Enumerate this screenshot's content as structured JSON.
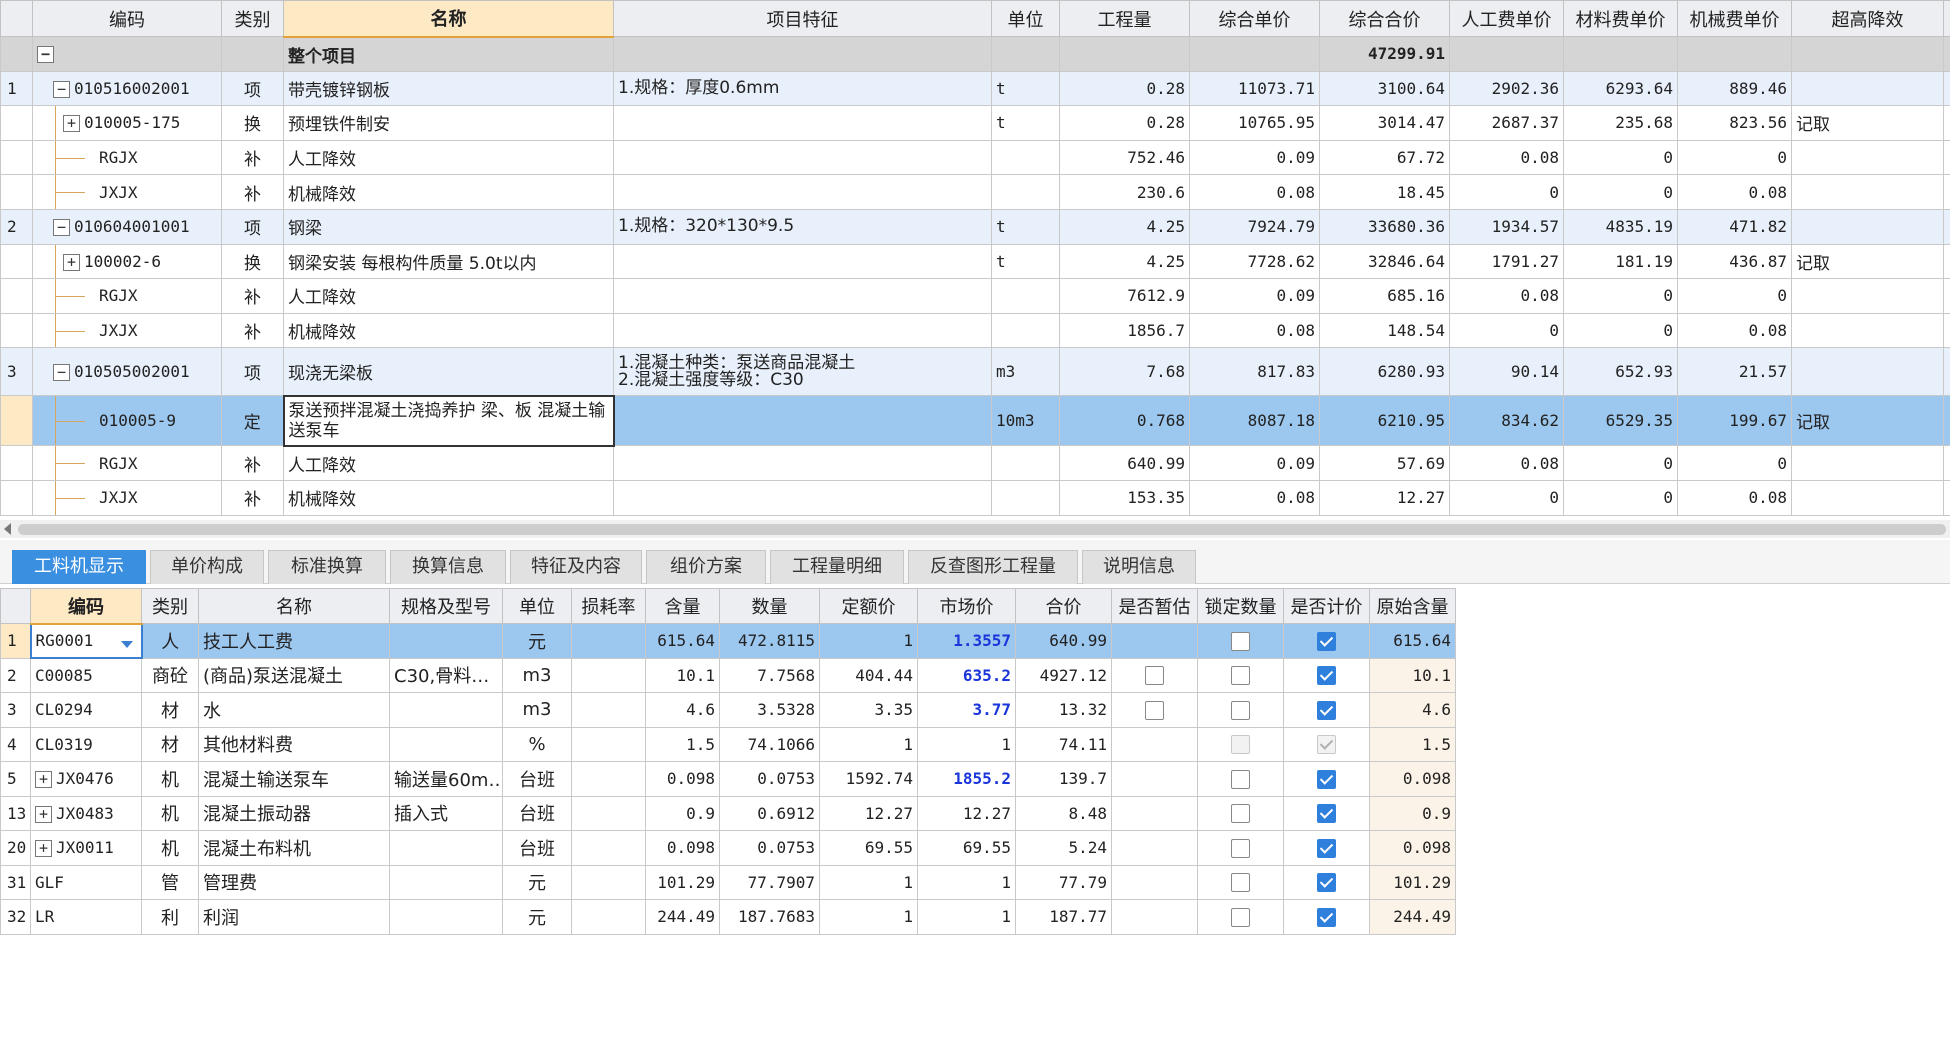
{
  "upper": {
    "headers": [
      "编码",
      "类别",
      "名称",
      "项目特征",
      "单位",
      "工程量",
      "综合单价",
      "综合合价",
      "人工费单价",
      "材料费单价",
      "机械费单价",
      "超高降效"
    ],
    "root": {
      "name": "整个项目",
      "total": "47299.91"
    },
    "rows": [
      {
        "no": "1",
        "code": "010516002001",
        "type": "项",
        "name": "带壳镀锌钢板",
        "feature": "1.规格：厚度0.6mm",
        "unit": "t",
        "qty": "0.28",
        "price": "11073.71",
        "total": "3100.64",
        "labor": "2902.36",
        "material": "6293.64",
        "machine": "889.46",
        "extra": ""
      },
      {
        "no": "",
        "code": "010005-175",
        "type": "换",
        "name": "预埋铁件制安",
        "feature": "",
        "unit": "t",
        "qty": "0.28",
        "price": "10765.95",
        "total": "3014.47",
        "labor": "2687.37",
        "material": "235.68",
        "machine": "823.56",
        "extra": "记取"
      },
      {
        "no": "",
        "code": "RGJX",
        "type": "补",
        "name": "人工降效",
        "feature": "",
        "unit": "",
        "qty": "752.46",
        "price": "0.09",
        "total": "67.72",
        "labor": "0.08",
        "material": "0",
        "machine": "0",
        "extra": ""
      },
      {
        "no": "",
        "code": "JXJX",
        "type": "补",
        "name": "机械降效",
        "feature": "",
        "unit": "",
        "qty": "230.6",
        "price": "0.08",
        "total": "18.45",
        "labor": "0",
        "material": "0",
        "machine": "0.08",
        "extra": ""
      },
      {
        "no": "2",
        "code": "010604001001",
        "type": "项",
        "name": "钢梁",
        "feature": "1.规格：320*130*9.5",
        "unit": "t",
        "qty": "4.25",
        "price": "7924.79",
        "total": "33680.36",
        "labor": "1934.57",
        "material": "4835.19",
        "machine": "471.82",
        "extra": ""
      },
      {
        "no": "",
        "code": "100002-6",
        "type": "换",
        "name": "钢梁安装 每根构件质量 5.0t以内",
        "feature": "",
        "unit": "t",
        "qty": "4.25",
        "price": "7728.62",
        "total": "32846.64",
        "labor": "1791.27",
        "material": "181.19",
        "machine": "436.87",
        "extra": "记取"
      },
      {
        "no": "",
        "code": "RGJX",
        "type": "补",
        "name": "人工降效",
        "feature": "",
        "unit": "",
        "qty": "7612.9",
        "price": "0.09",
        "total": "685.16",
        "labor": "0.08",
        "material": "0",
        "machine": "0",
        "extra": ""
      },
      {
        "no": "",
        "code": "JXJX",
        "type": "补",
        "name": "机械降效",
        "feature": "",
        "unit": "",
        "qty": "1856.7",
        "price": "0.08",
        "total": "148.54",
        "labor": "0",
        "material": "0",
        "machine": "0.08",
        "extra": ""
      },
      {
        "no": "3",
        "code": "010505002001",
        "type": "项",
        "name": "现浇无梁板",
        "feature": "1.混凝土种类：泵送商品混凝土\n2.混凝土强度等级：C30",
        "unit": "m3",
        "qty": "7.68",
        "price": "817.83",
        "total": "6280.93",
        "labor": "90.14",
        "material": "652.93",
        "machine": "21.57",
        "extra": ""
      },
      {
        "no": "",
        "code": "010005-9",
        "type": "定",
        "name": "泵送预拌混凝土浇捣养护 梁、板 混凝土输送泵车",
        "feature": "",
        "unit": "10m3",
        "qty": "0.768",
        "price": "8087.18",
        "total": "6210.95",
        "labor": "834.62",
        "material": "6529.35",
        "machine": "199.67",
        "extra": "记取"
      },
      {
        "no": "",
        "code": "RGJX",
        "type": "补",
        "name": "人工降效",
        "feature": "",
        "unit": "",
        "qty": "640.99",
        "price": "0.09",
        "total": "57.69",
        "labor": "0.08",
        "material": "0",
        "machine": "0",
        "extra": ""
      },
      {
        "no": "",
        "code": "JXJX",
        "type": "补",
        "name": "机械降效",
        "feature": "",
        "unit": "",
        "qty": "153.35",
        "price": "0.08",
        "total": "12.27",
        "labor": "0",
        "material": "0",
        "machine": "0.08",
        "extra": ""
      }
    ]
  },
  "tabs": [
    "工料机显示",
    "单价构成",
    "标准换算",
    "换算信息",
    "特征及内容",
    "组价方案",
    "工程量明细",
    "反查图形工程量",
    "说明信息"
  ],
  "lower": {
    "headers": [
      "编码",
      "类别",
      "名称",
      "规格及型号",
      "单位",
      "损耗率",
      "含量",
      "数量",
      "定额价",
      "市场价",
      "合价",
      "是否暂估",
      "锁定数量",
      "是否计价",
      "原始含量"
    ],
    "rows": [
      {
        "no": "1",
        "code": "RG0001",
        "type": "人",
        "name": "技工人工费",
        "spec": "",
        "unit": "元",
        "loss": "",
        "content": "615.64",
        "qty": "472.8115",
        "quota": "1",
        "market": "1.3557",
        "total": "640.99",
        "orig": "615.64"
      },
      {
        "no": "2",
        "code": "C00085",
        "type": "商砼",
        "name": "(商品)泵送混凝土",
        "spec": "C30,骨料…",
        "unit": "m3",
        "loss": "",
        "content": "10.1",
        "qty": "7.7568",
        "quota": "404.44",
        "market": "635.2",
        "total": "4927.12",
        "orig": "10.1"
      },
      {
        "no": "3",
        "code": "CL0294",
        "type": "材",
        "name": "水",
        "spec": "",
        "unit": "m3",
        "loss": "",
        "content": "4.6",
        "qty": "3.5328",
        "quota": "3.35",
        "market": "3.77",
        "total": "13.32",
        "orig": "4.6"
      },
      {
        "no": "4",
        "code": "CL0319",
        "type": "材",
        "name": "其他材料费",
        "spec": "",
        "unit": "%",
        "loss": "",
        "content": "1.5",
        "qty": "74.1066",
        "quota": "1",
        "market": "1",
        "total": "74.11",
        "orig": "1.5"
      },
      {
        "no": "5",
        "code": "JX0476",
        "type": "机",
        "name": "混凝土输送泵车",
        "spec": "输送量60m…",
        "unit": "台班",
        "loss": "",
        "content": "0.098",
        "qty": "0.0753",
        "quota": "1592.74",
        "market": "1855.2",
        "total": "139.7",
        "orig": "0.098"
      },
      {
        "no": "13",
        "code": "JX0483",
        "type": "机",
        "name": "混凝土振动器",
        "spec": "插入式",
        "unit": "台班",
        "loss": "",
        "content": "0.9",
        "qty": "0.6912",
        "quota": "12.27",
        "market": "12.27",
        "total": "8.48",
        "orig": "0.9"
      },
      {
        "no": "20",
        "code": "JX0011",
        "type": "机",
        "name": "混凝土布料机",
        "spec": "",
        "unit": "台班",
        "loss": "",
        "content": "0.098",
        "qty": "0.0753",
        "quota": "69.55",
        "market": "69.55",
        "total": "5.24",
        "orig": "0.098"
      },
      {
        "no": "31",
        "code": "GLF",
        "type": "管",
        "name": "管理费",
        "spec": "",
        "unit": "元",
        "loss": "",
        "content": "101.29",
        "qty": "77.7907",
        "quota": "1",
        "market": "1",
        "total": "77.79",
        "orig": "101.29"
      },
      {
        "no": "32",
        "code": "LR",
        "type": "利",
        "name": "利润",
        "spec": "",
        "unit": "元",
        "loss": "",
        "content": "244.49",
        "qty": "187.7683",
        "quota": "1",
        "market": "1",
        "total": "187.77",
        "orig": "244.49"
      }
    ]
  },
  "colors": {
    "accent": "#3a8fe0",
    "selected_row": "#9cc7ee",
    "header_highlight": "#fde9c4",
    "market_changed": "#1a35d9"
  }
}
